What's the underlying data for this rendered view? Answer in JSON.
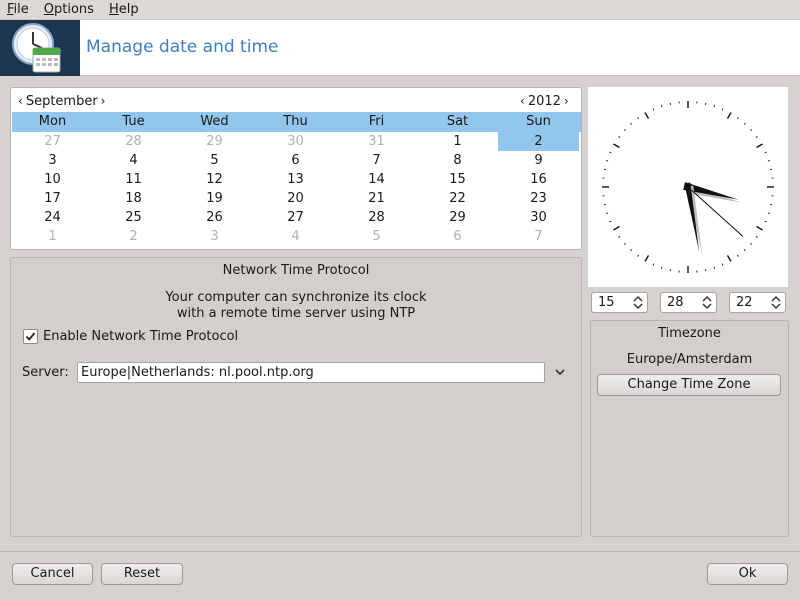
{
  "menu": {
    "items": [
      {
        "mnemonic": "F",
        "rest": "ile"
      },
      {
        "mnemonic": "O",
        "rest": "ptions"
      },
      {
        "mnemonic": "H",
        "rest": "elp"
      }
    ]
  },
  "header": {
    "title": "Manage date and time"
  },
  "calendar": {
    "month": "September",
    "year": "2012",
    "weekdays": [
      "Mon",
      "Tue",
      "Wed",
      "Thu",
      "Fri",
      "Sat",
      "Sun"
    ],
    "weeks": [
      [
        [
          "27",
          "dim"
        ],
        [
          "28",
          "dim"
        ],
        [
          "29",
          "dim"
        ],
        [
          "30",
          "dim"
        ],
        [
          "31",
          "dim"
        ],
        [
          "1",
          ""
        ],
        [
          "2",
          "sel"
        ]
      ],
      [
        [
          "3",
          ""
        ],
        [
          "4",
          ""
        ],
        [
          "5",
          ""
        ],
        [
          "6",
          ""
        ],
        [
          "7",
          ""
        ],
        [
          "8",
          ""
        ],
        [
          "9",
          ""
        ]
      ],
      [
        [
          "10",
          ""
        ],
        [
          "11",
          ""
        ],
        [
          "12",
          ""
        ],
        [
          "13",
          ""
        ],
        [
          "14",
          ""
        ],
        [
          "15",
          ""
        ],
        [
          "16",
          ""
        ]
      ],
      [
        [
          "17",
          ""
        ],
        [
          "18",
          ""
        ],
        [
          "19",
          ""
        ],
        [
          "20",
          ""
        ],
        [
          "21",
          ""
        ],
        [
          "22",
          ""
        ],
        [
          "23",
          ""
        ]
      ],
      [
        [
          "24",
          ""
        ],
        [
          "25",
          ""
        ],
        [
          "26",
          ""
        ],
        [
          "27",
          ""
        ],
        [
          "28",
          ""
        ],
        [
          "29",
          ""
        ],
        [
          "30",
          ""
        ]
      ],
      [
        [
          "1",
          "dim"
        ],
        [
          "2",
          "dim"
        ],
        [
          "3",
          "dim"
        ],
        [
          "4",
          "dim"
        ],
        [
          "5",
          "dim"
        ],
        [
          "6",
          "dim"
        ],
        [
          "7",
          "dim"
        ]
      ]
    ]
  },
  "clock": {
    "hour": "15",
    "minute": "28",
    "second": "22"
  },
  "ntp": {
    "title": "Network Time Protocol",
    "desc_line1": "Your computer can synchronize its clock",
    "desc_line2": "with a remote time server using NTP",
    "enable_label": "Enable Network Time Protocol",
    "enabled": true,
    "server_label": "Server:",
    "server_value": "Europe|Netherlands: nl.pool.ntp.org"
  },
  "timezone": {
    "title": "Timezone",
    "value": "Europe/Amsterdam",
    "change_label": "Change Time Zone"
  },
  "buttons": {
    "cancel": "Cancel",
    "reset": "Reset",
    "ok": "Ok"
  },
  "colors": {
    "accent": "#3f7fc6",
    "selection": "#93c6ec",
    "banner_icon_bg": "#1e3552"
  },
  "icons": {
    "banner": "clock-calendar-icon",
    "check": "checkmark-icon",
    "dropdown": "chevron-down-icon",
    "spinner": "up-down-arrows-icon"
  }
}
